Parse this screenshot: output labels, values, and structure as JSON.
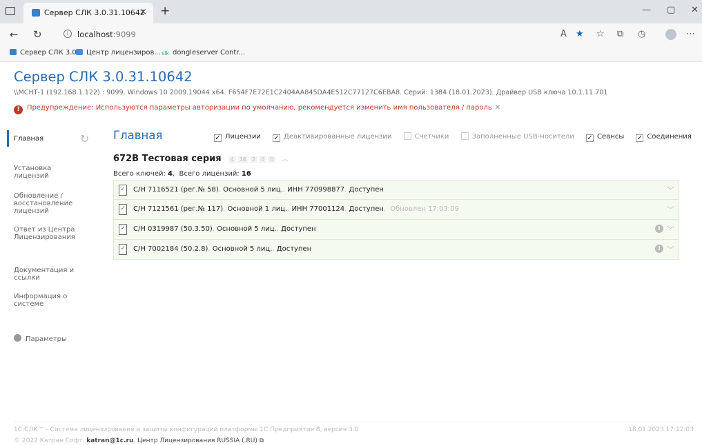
{
  "browser": {
    "tab_title": "Сервер СЛК 3.0.31.10642",
    "url_host": "localhost",
    "url_port": ":9099",
    "bookmarks": [
      {
        "label": "Сервер СЛК 3.0",
        "icon": "slk-icon"
      },
      {
        "label": "Центр лицензиров...",
        "icon": "monitor-icon"
      },
      {
        "label": "dongleserver Contr...",
        "icon": "slk-logo-icon"
      }
    ]
  },
  "header": {
    "title": "Сервер СЛК 3.0.31.10642",
    "host": "\\\\МСНТ-1 (192.168.1.122) : 9099",
    "os": "Windows 10 2009.19044 x64",
    "hwid": "F654F7E72E1C2404AA845DA4E512C77127C6EBA8",
    "series": "Серий: 1384 (18.01.2023)",
    "driver": "Драйвер USB ключа 10.1.11.701",
    "warning": "Предупреждение: Используются параметры авторизации по умолчанию, рекомендуется изменить имя пользователя / пароль"
  },
  "sidebar": {
    "items": [
      {
        "label": "Главная"
      },
      {
        "label": "Установка лицензий"
      },
      {
        "label": "Обновление / восстановление лицензий"
      },
      {
        "label": "Ответ из Центра Лицензирования"
      },
      {
        "label": "Документация и ссылки"
      },
      {
        "label": "Информация о системе"
      },
      {
        "label": "Параметры"
      }
    ]
  },
  "main": {
    "title": "Главная",
    "filters": [
      {
        "label": "Лицензии",
        "checked": true
      },
      {
        "label": "Деактивированные лицензии",
        "checked": true
      },
      {
        "label": "Счетчики",
        "checked": false
      },
      {
        "label": "Заполненные USB-носители",
        "checked": false
      },
      {
        "label": "Сеансы",
        "checked": true
      },
      {
        "label": "Соединения",
        "checked": true
      }
    ],
    "series_name": "672В Тестовая серия",
    "series_counters": [
      "4",
      "16",
      "2",
      "0",
      "0"
    ],
    "totals_keys_label": "Всего ключей:",
    "totals_keys": "4",
    "totals_licenses_label": "Всего лицензий:",
    "totals_licenses": "16",
    "rows": [
      {
        "sn": "С/Н 7116521 (рег.№ 58)",
        "type": "Основной 5 лиц.",
        "inn": "ИНН 770998877",
        "status": "Доступен",
        "updated": "",
        "icon": "file-check-icon"
      },
      {
        "sn": "С/Н 7121561 (рег.№ 117)",
        "type": "Основной 1 лиц.",
        "inn": "ИНН 77001124",
        "status": "Доступен",
        "updated": "Обновлен 17:03:09",
        "icon": "file-check-icon"
      },
      {
        "sn": "С/Н 0319987 (50.3.50)",
        "type": "Основной 5 лиц.",
        "inn": "",
        "status": "Доступен",
        "updated": "",
        "icon": "usb-key-icon"
      },
      {
        "sn": "С/Н 7002184 (50.2.8)",
        "type": "Основной 5 лиц.",
        "inn": "",
        "status": "Доступен",
        "updated": "",
        "icon": "usb-key-icon"
      }
    ]
  },
  "footer": {
    "line1": "1С:СЛК™ - Система лицензирования и защиты конфигураций платформы 1С:Предприятие 8, версия 3.0",
    "timestamp": "18.01.2023 17:12:03",
    "copyright": "© 2022 Катран Софт.",
    "email": "katran@1c.ru",
    "center": "Центр Лицензирования RUSSIA (.RU)"
  }
}
